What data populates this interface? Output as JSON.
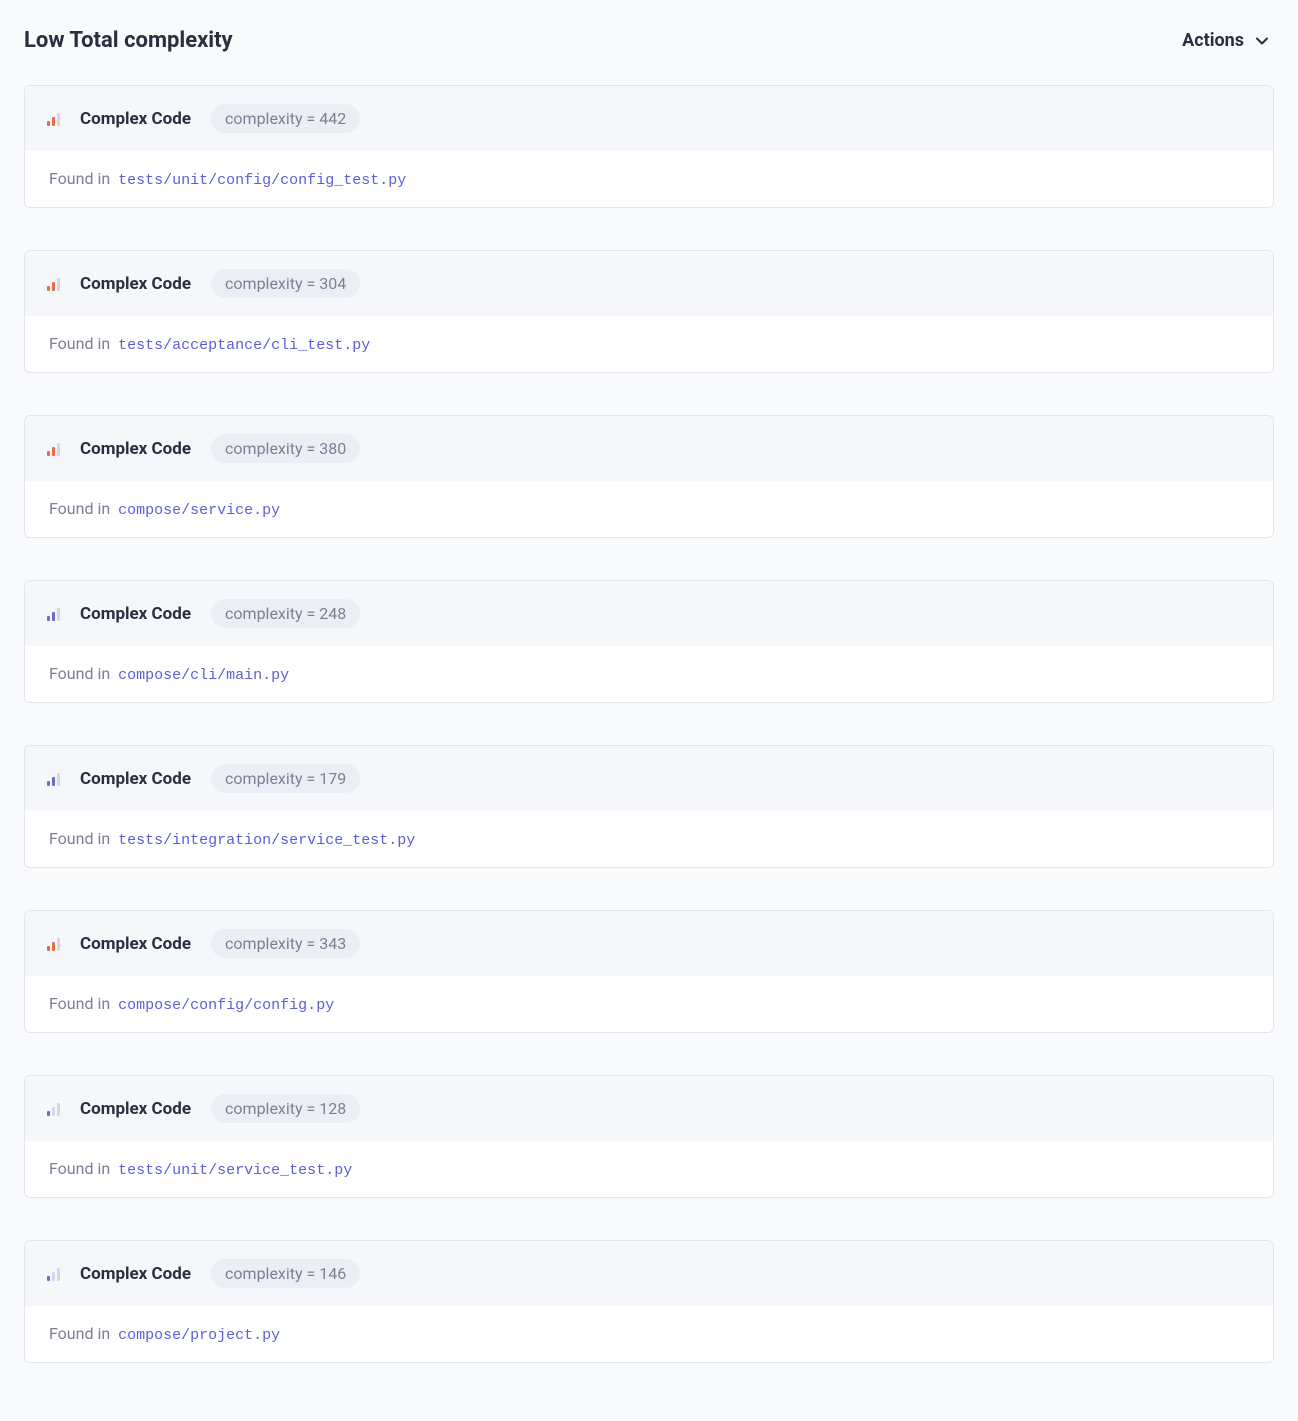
{
  "header": {
    "title": "Low Total complexity",
    "actions_label": "Actions"
  },
  "labels": {
    "issue_title": "Complex Code",
    "complexity_prefix": "complexity = ",
    "found_in": "Found in "
  },
  "colors": {
    "bar_orange": "#e86b4a",
    "bar_inactive": "#d4d7e6",
    "bar_purple": "#6a6dc9"
  },
  "issues": [
    {
      "complexity": 442,
      "file": "tests/unit/config/config_test.py",
      "severity": "medium"
    },
    {
      "complexity": 304,
      "file": "tests/acceptance/cli_test.py",
      "severity": "medium"
    },
    {
      "complexity": 380,
      "file": "compose/service.py",
      "severity": "medium"
    },
    {
      "complexity": 248,
      "file": "compose/cli/main.py",
      "severity": "low"
    },
    {
      "complexity": 179,
      "file": "tests/integration/service_test.py",
      "severity": "low"
    },
    {
      "complexity": 343,
      "file": "compose/config/config.py",
      "severity": "medium"
    },
    {
      "complexity": 128,
      "file": "tests/unit/service_test.py",
      "severity": "verylow"
    },
    {
      "complexity": 146,
      "file": "compose/project.py",
      "severity": "verylow"
    }
  ]
}
